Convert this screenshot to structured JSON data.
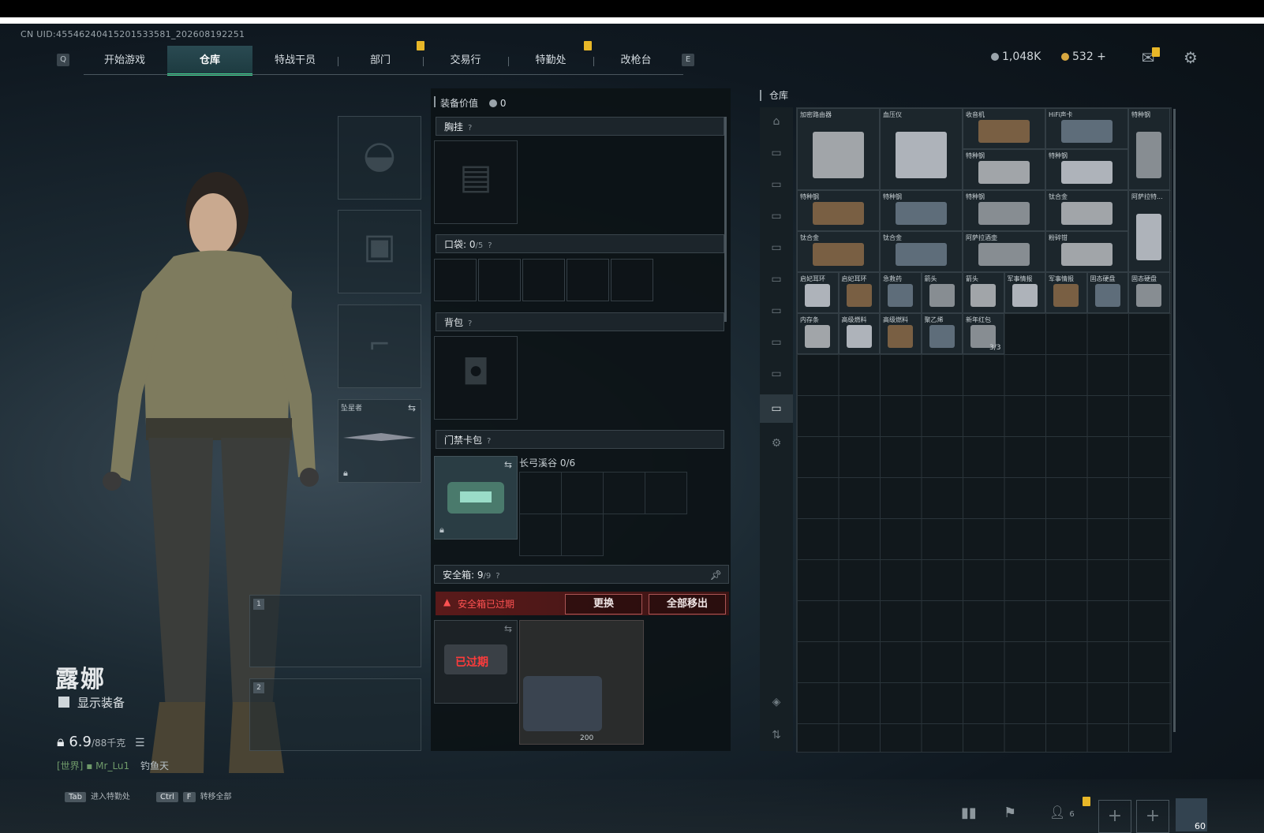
{
  "header": {
    "uid": "CN UID:4554624041520153358­1_202608192251",
    "tabs": [
      {
        "label": "开始游戏"
      },
      {
        "label": "仓库",
        "active": true
      },
      {
        "label": "特战干员"
      },
      {
        "label": "部门"
      },
      {
        "label": "交易行"
      },
      {
        "label": "特勤处"
      },
      {
        "label": "改枪台"
      }
    ],
    "key_left": "Q",
    "key_right": "E",
    "currency_silver": "1,048K",
    "currency_gold": "532 +",
    "colors": {
      "accent": "#3fcf8e",
      "badge": "#e8b728"
    }
  },
  "character": {
    "name": "露娜",
    "show_gear_label": "显示装备",
    "weight": "6.9",
    "weight_max": "/88千克",
    "chat_channel": "[世界]",
    "chat_user": "Mr_Lu1",
    "chat_text": "钓鱼天"
  },
  "gear": {
    "melee_label": "坠星者",
    "weapon_slot_1": "1",
    "weapon_slot_2": "2"
  },
  "loadout": {
    "equip_value_label": "装备价值",
    "equip_value": "0",
    "chest_rig_label": "胸挂",
    "pocket_label": "口袋:",
    "pocket_count": "0",
    "pocket_max": "/5",
    "backpack_label": "背包",
    "keycard_label": "门禁卡包",
    "keycard_zone": "长弓溪谷",
    "keycard_count": "0/6",
    "safebox_label": "安全箱:",
    "safebox_count": "9",
    "safebox_max": "/9",
    "safebox_expired": "安全箱已过期",
    "expired_stamp": "已过期",
    "replace_button": "更换",
    "move_all_button": "全部移出",
    "safebox_item_value": "200"
  },
  "warehouse": {
    "title": "仓库",
    "items": [
      {
        "name": "加密路由器",
        "count": ""
      },
      {
        "name": "血压仪",
        "count": ""
      },
      {
        "name": "收音机",
        "count": ""
      },
      {
        "name": "HiFi声卡",
        "count": ""
      },
      {
        "name": "特种钢",
        "count": ""
      },
      {
        "name": "特种钢",
        "count": ""
      },
      {
        "name": "特种钢",
        "count": ""
      },
      {
        "name": "特种钢",
        "count": ""
      },
      {
        "name": "特种钢",
        "count": ""
      },
      {
        "name": "特种钢",
        "count": ""
      },
      {
        "name": "钛合金",
        "count": ""
      },
      {
        "name": "阿萨拉特...",
        "count": ""
      },
      {
        "name": "钛合金",
        "count": ""
      },
      {
        "name": "钛合金",
        "count": ""
      },
      {
        "name": "阿萨拉酒壶",
        "count": ""
      },
      {
        "name": "粉碎钳",
        "count": ""
      },
      {
        "name": "启妃耳环",
        "count": ""
      },
      {
        "name": "启妃耳环",
        "count": ""
      },
      {
        "name": "急救药",
        "count": ""
      },
      {
        "name": "箭头",
        "count": ""
      },
      {
        "name": "箭头",
        "count": ""
      },
      {
        "name": "军事情报",
        "count": ""
      },
      {
        "name": "军事情报",
        "count": ""
      },
      {
        "name": "固态硬盘",
        "count": ""
      },
      {
        "name": "固态硬盘",
        "count": ""
      },
      {
        "name": "内存条",
        "count": ""
      },
      {
        "name": "高级燃料",
        "count": ""
      },
      {
        "name": "高级燃料",
        "count": ""
      },
      {
        "name": "聚乙烯",
        "count": ""
      },
      {
        "name": "新年红包",
        "count": "3/3"
      }
    ]
  },
  "footer": {
    "tab_key": "Tab",
    "tab_label": "进入特勤处",
    "ctrl_key": "Ctrl",
    "f_key": "F",
    "ctrl_label": "转移全部",
    "level": "60",
    "friends": "6"
  }
}
